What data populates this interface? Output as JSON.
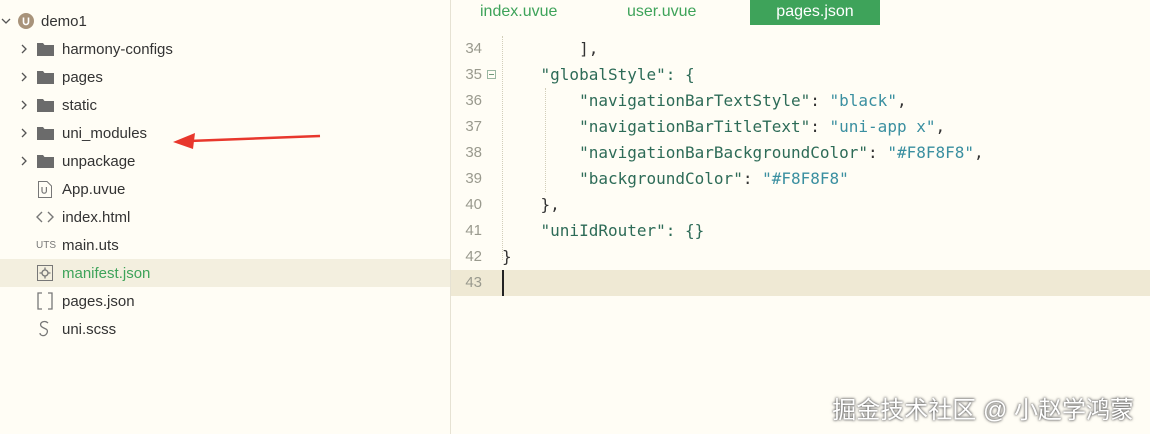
{
  "sidebar": {
    "project": "demo1",
    "items": [
      {
        "label": "harmony-configs",
        "type": "folder",
        "icon": "folder-icon"
      },
      {
        "label": "pages",
        "type": "folder",
        "icon": "folder-icon"
      },
      {
        "label": "static",
        "type": "folder",
        "icon": "folder-icon"
      },
      {
        "label": "uni_modules",
        "type": "folder",
        "icon": "folder-icon"
      },
      {
        "label": "unpackage",
        "type": "folder",
        "icon": "folder-icon"
      },
      {
        "label": "App.uvue",
        "type": "file",
        "icon": "uvue-file-icon"
      },
      {
        "label": "index.html",
        "type": "file",
        "icon": "html-file-icon"
      },
      {
        "label": "main.uts",
        "type": "file",
        "icon": "uts-file-icon",
        "icon_text": "UTS"
      },
      {
        "label": "manifest.json",
        "type": "file",
        "icon": "manifest-file-icon",
        "selected": true
      },
      {
        "label": "pages.json",
        "type": "file",
        "icon": "json-file-icon"
      },
      {
        "label": "uni.scss",
        "type": "file",
        "icon": "scss-file-icon"
      }
    ]
  },
  "tabs": [
    {
      "label": "index.uvue",
      "active": false
    },
    {
      "label": "user.uvue",
      "active": false
    },
    {
      "label": "pages.json",
      "active": true
    }
  ],
  "editor": {
    "lines": [
      {
        "num": "34",
        "text": "        ],"
      },
      {
        "num": "35",
        "text": "    \"globalStyle\": {",
        "fold": true
      },
      {
        "num": "36",
        "text": "        \"navigationBarTextStyle\": \"black\","
      },
      {
        "num": "37",
        "text": "        \"navigationBarTitleText\": \"uni-app x\","
      },
      {
        "num": "38",
        "text": "        \"navigationBarBackgroundColor\": \"#F8F8F8\","
      },
      {
        "num": "39",
        "text": "        \"backgroundColor\": \"#F8F8F8\""
      },
      {
        "num": "40",
        "text": "    },"
      },
      {
        "num": "41",
        "text": "    \"uniIdRouter\": {}"
      },
      {
        "num": "42",
        "text": "}"
      },
      {
        "num": "43",
        "text": "",
        "current": true
      }
    ]
  },
  "watermark": "掘金技术社区 @ 小赵学鸿蒙",
  "colors": {
    "accent": "#3ea35a",
    "arrow": "#e8372c",
    "background": "#fffdf5",
    "current_line": "#efe9d4"
  }
}
